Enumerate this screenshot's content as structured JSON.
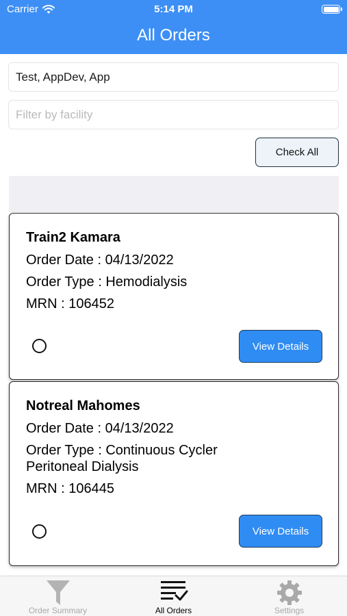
{
  "status_bar": {
    "carrier": "Carrier",
    "time": "5:14 PM"
  },
  "header": {
    "title": "All Orders"
  },
  "filters": {
    "patient_value": "Test, AppDev, App",
    "facility_placeholder": "Filter by facility"
  },
  "actions": {
    "check_all_label": "Check All"
  },
  "orders": [
    {
      "patient_name": "Train2 Kamara",
      "order_date": "Order Date : 04/13/2022",
      "order_type_line1": "Order Type : Hemodialysis",
      "order_type_line2": "",
      "mrn": "MRN : 106452",
      "view_label": "View Details"
    },
    {
      "patient_name": "Notreal Mahomes",
      "order_date": "Order Date : 04/13/2022",
      "order_type_line1": "Order Type : Continuous Cycler",
      "order_type_line2": "Peritoneal Dialysis",
      "mrn": "MRN : 106445",
      "view_label": "View Details"
    }
  ],
  "tab_bar": {
    "tabs": [
      {
        "label": "Order Summary",
        "icon": "funnel-icon",
        "active": false
      },
      {
        "label": "All Orders",
        "icon": "checklist-icon",
        "active": true
      },
      {
        "label": "Settings",
        "icon": "gear-icon",
        "active": false
      }
    ]
  },
  "colors": {
    "accent": "#3d8ff5",
    "button": "#2f8cf3",
    "inactive_tab": "#a8a8a8"
  }
}
